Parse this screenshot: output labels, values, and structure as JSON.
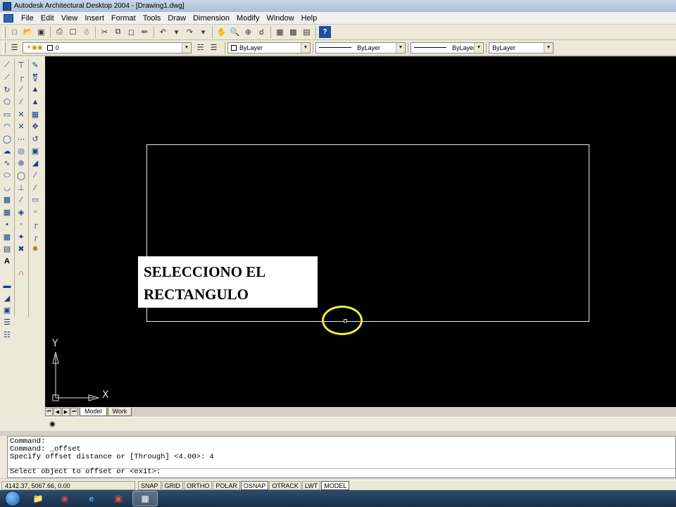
{
  "window": {
    "title": "Autodesk Architectural Desktop 2004 - [Drawing1.dwg]"
  },
  "menu": {
    "items": [
      "File",
      "Edit",
      "View",
      "Insert",
      "Format",
      "Tools",
      "Draw",
      "Dimension",
      "Modify",
      "Window",
      "Help"
    ]
  },
  "toolbar": {
    "standard_icons": [
      "new-icon",
      "open-icon",
      "save-icon",
      "print-icon",
      "preview-icon",
      "publish-icon",
      "cut-icon",
      "copy-icon",
      "paste-icon",
      "match-icon",
      "undo-icon",
      "redo-icon",
      "pan-icon",
      "zoom-realtime-icon",
      "zoom-window-icon",
      "zoom-previous-icon",
      "properties-icon",
      "design-center-icon",
      "tool-palettes-icon",
      "help-icon"
    ],
    "layer_value": "0",
    "color_value": "ByLayer",
    "linetype_value": "ByLayer",
    "lineweight_value": "ByLayer",
    "plotstyle_value": "ByLayer"
  },
  "drawing": {
    "annotation": "SELECCIONO EL RECTANGULO",
    "annotation_line1": "SELECCIONO EL",
    "annotation_line2": "RECTANGULO",
    "highlight_color": "#f2ee3a",
    "ucs_y": "Y",
    "ucs_x": "X"
  },
  "layout_tabs": {
    "tabs": [
      "Model",
      "Work"
    ],
    "active": "Model"
  },
  "command": {
    "history": [
      "Command:",
      "Command: _offset",
      "Specify offset distance or [Through] <4.00>: 4"
    ],
    "prompt": "Select object to offset or <exit>:"
  },
  "status": {
    "coordinates": "4142.37, 5067.66, 0.00",
    "toggles": [
      "SNAP",
      "GRID",
      "ORTHO",
      "POLAR",
      "OSNAP",
      "OTRACK",
      "LWT",
      "MODEL"
    ],
    "on": [
      "OSNAP",
      "MODEL"
    ]
  },
  "taskbar": {
    "items": [
      "explorer-icon",
      "chrome-icon",
      "ie-icon",
      "office-icon",
      "autocad-icon"
    ],
    "active": "autocad-icon"
  }
}
